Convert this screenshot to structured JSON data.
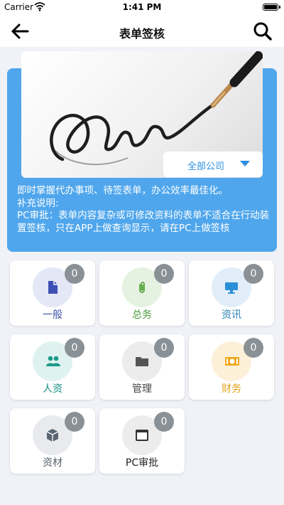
{
  "status_bar": {
    "carrier": "Carrier",
    "time": "1:41 PM"
  },
  "nav": {
    "title": "表单签核"
  },
  "banner": {
    "company_select": "全部公司",
    "description_lines": [
      "即时掌握代办事项、待签表单，办公效率最佳化。",
      "补充说明:",
      "PC审批：表单内容复杂或可修改资料的表单不适合在行动装置签核，只在APP上做查询显示，请在PC上做签核"
    ]
  },
  "categories": [
    {
      "label": "一般",
      "count": "0",
      "icon": "document-icon",
      "label_color": "#3a55a6",
      "icon_bg": "#e3e7f6",
      "icon_color": "#3f51b5"
    },
    {
      "label": "总务",
      "count": "0",
      "icon": "paperclip-icon",
      "label_color": "#4c9a3c",
      "icon_bg": "#e6f2e1",
      "icon_color": "#5aa642"
    },
    {
      "label": "资讯",
      "count": "0",
      "icon": "monitor-icon",
      "label_color": "#2a82b5",
      "icon_bg": "#e1eef9",
      "icon_color": "#2b8fd8"
    },
    {
      "label": "人资",
      "count": "0",
      "icon": "people-icon",
      "label_color": "#178f85",
      "icon_bg": "#dff2ef",
      "icon_color": "#1b9a8b"
    },
    {
      "label": "管理",
      "count": "0",
      "icon": "folder-icon",
      "label_color": "#444444",
      "icon_bg": "#ececec",
      "icon_color": "#555555"
    },
    {
      "label": "财务",
      "count": "0",
      "icon": "money-icon",
      "label_color": "#e3a21a",
      "icon_bg": "#fdf0d8",
      "icon_color": "#f0a717"
    },
    {
      "label": "资材",
      "count": "0",
      "icon": "cube-icon",
      "label_color": "#55606b",
      "icon_bg": "#e8eaee",
      "icon_color": "#5a6673"
    },
    {
      "label": "PC审批",
      "count": "0",
      "icon": "window-icon",
      "label_color": "#222222",
      "icon_bg": "#ececec",
      "icon_color": "#333333"
    }
  ]
}
